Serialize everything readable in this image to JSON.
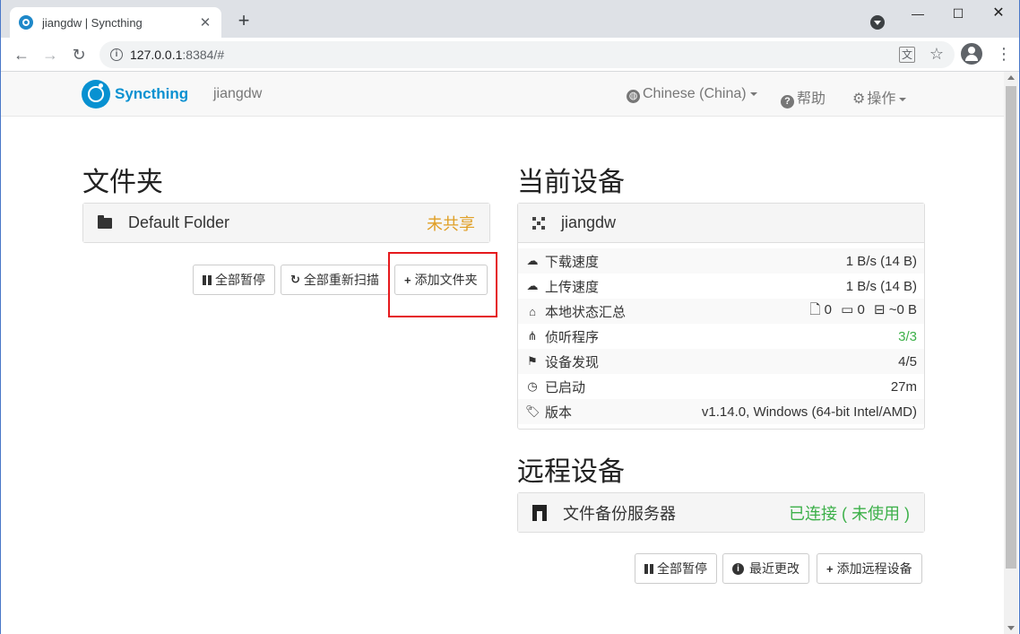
{
  "browser": {
    "tab_title": "jiangdw | Syncthing",
    "tab_close": "✕",
    "new_tab": "+",
    "url_host": "127.0.0.1",
    "url_rest": ":8384/#",
    "window_min": "—",
    "window_max": "☐",
    "window_close": "✕"
  },
  "navbar": {
    "brand": "Syncthing",
    "device_name": "jiangdw",
    "language": "Chinese (China)",
    "help": "帮助",
    "actions": "操作"
  },
  "folders": {
    "heading": "文件夹",
    "items": [
      {
        "name": "Default Folder",
        "status": "未共享"
      }
    ],
    "pause_all": "全部暂停",
    "rescan_all": "全部重新扫描",
    "add_folder": "添加文件夹"
  },
  "this_device": {
    "heading": "当前设备",
    "name": "jiangdw",
    "stats": [
      {
        "icon": "cloud-download-icon",
        "label": "下载速度",
        "value": "1 B/s (14 B)"
      },
      {
        "icon": "cloud-upload-icon",
        "label": "上传速度",
        "value": "1 B/s (14 B)"
      },
      {
        "icon": "home-icon",
        "label": "本地状态汇总",
        "files": "0",
        "dirs": "0",
        "size": "~0 B"
      },
      {
        "icon": "sitemap-icon",
        "label": "侦听程序",
        "value": "3/3"
      },
      {
        "icon": "signpost-icon",
        "label": "设备发现",
        "value": "4/5"
      },
      {
        "icon": "clock-icon",
        "label": "已启动",
        "value": "27m"
      },
      {
        "icon": "tag-icon",
        "label": "版本",
        "value": "v1.14.0, Windows (64-bit Intel/AMD)"
      }
    ]
  },
  "remote_devices": {
    "heading": "远程设备",
    "items": [
      {
        "name": "文件备份服务器",
        "status": "已连接 ( 未使用 )"
      }
    ],
    "pause_all": "全部暂停",
    "recent_changes": "最近更改",
    "add_remote": "添加远程设备"
  },
  "colors": {
    "brand": "#0891d1",
    "unshared": "#e09f25",
    "connected": "#3cb049",
    "highlight": "#e5191d"
  }
}
